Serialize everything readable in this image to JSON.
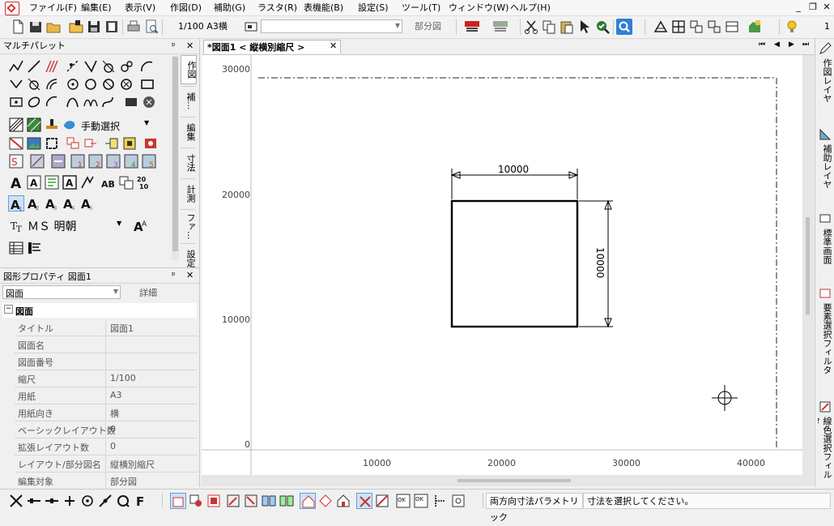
{
  "menu": [
    "ファイル(F)",
    "編集(E)",
    "表示(V)",
    "作図(D)",
    "補助(G)",
    "ラスタ(R)",
    "表機能(B)",
    "設定(S)",
    "ツール(T)",
    "ウィンドウ(W)",
    "ヘルプ(H)"
  ],
  "window_controls": {
    "minimize": "_",
    "restore": "❐",
    "close": "✕"
  },
  "toolbar": {
    "scale_label": "1/100 A3横",
    "layer_combo": "",
    "partial_label": "部分図",
    "right_number": "1"
  },
  "palette": {
    "title": "マルチパレット",
    "pin": "ᵖ",
    "close": "✕",
    "fill_mode": "手動選択",
    "font_name": "ＭＳ 明朝",
    "vertical_tabs": [
      "作図",
      "補...",
      "編集",
      "寸法",
      "計測",
      "ファ...",
      "設定"
    ]
  },
  "properties": {
    "title": "図形プロパティ 図面1",
    "pin": "ᵖ",
    "close": "✕",
    "selected_type": "図面",
    "detail_button": "詳細",
    "group_label": "図面",
    "rows": [
      {
        "key": "タイトル",
        "value": "図面1"
      },
      {
        "key": "図面名",
        "value": ""
      },
      {
        "key": "図面番号",
        "value": ""
      },
      {
        "key": "縮尺",
        "value": "1/100"
      },
      {
        "key": "用紙",
        "value": "A3"
      },
      {
        "key": "用紙向き",
        "value": "横"
      },
      {
        "key": "ベーシックレイアウト数",
        "value": "0"
      },
      {
        "key": "拡張レイアウト数",
        "value": "0"
      },
      {
        "key": "レイアウト/部分図名",
        "value": "縦横別縮尺"
      },
      {
        "key": "編集対象",
        "value": "部分図"
      }
    ]
  },
  "document": {
    "tab_title": "*図面1 < 縦横別縮尺 >",
    "tab_close": "✕",
    "nav": [
      "⏮",
      "◀",
      "▶",
      "⏭"
    ]
  },
  "drawing": {
    "y_ticks": [
      "30000",
      "20000",
      "10000",
      "0"
    ],
    "x_ticks": [
      "10000",
      "20000",
      "30000",
      "40000"
    ],
    "dim_horizontal": "10000",
    "dim_vertical": "10000"
  },
  "right_tabs": [
    "作図レイヤ",
    "補助レイヤ",
    "標準画面",
    "要素選択フィルタ",
    "線色選択フィルタ"
  ],
  "status": {
    "mode": "両方向寸法パラメトリック",
    "message": "寸法を選択してください。"
  }
}
